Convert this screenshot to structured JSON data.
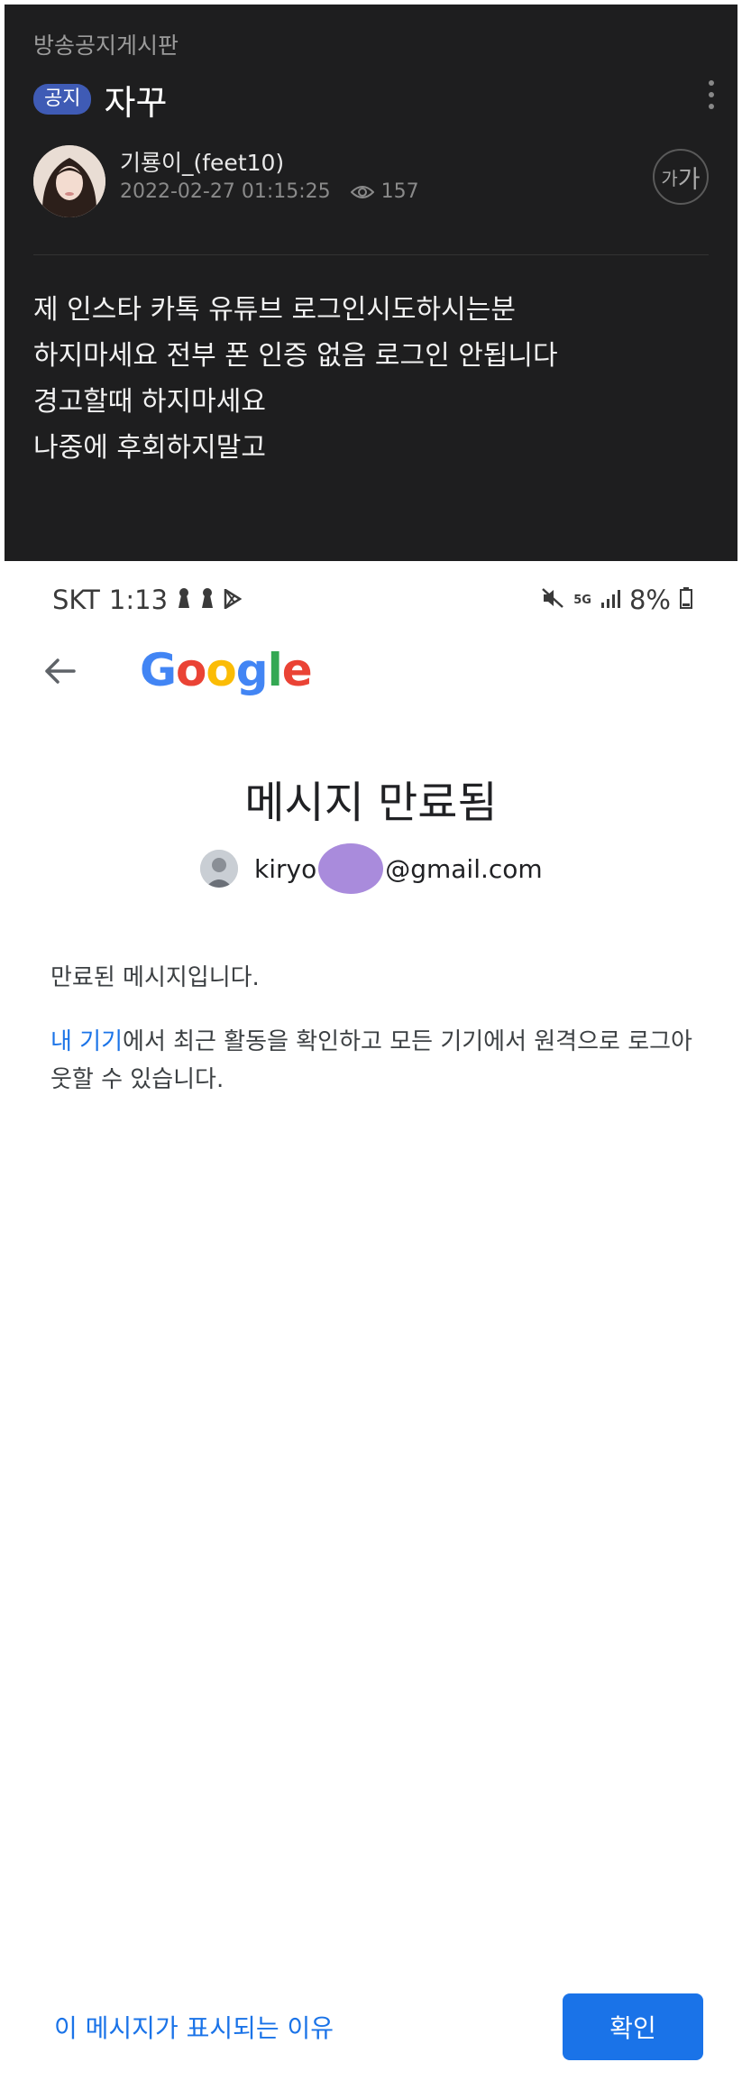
{
  "post": {
    "board_name": "방송공지게시판",
    "badge": "공지",
    "title": "자꾸",
    "author": "기룡이_(feet10)",
    "datetime": "2022-02-27 01:15:25",
    "views": "157",
    "font_button_small": "가",
    "font_button_large": "가",
    "body_lines": [
      "제 인스타 카톡 유튜브 로그인시도하시는분",
      "하지마세요 전부 폰 인증 없음 로그인 안됩니다",
      "경고할때 하지마세요",
      "나중에 후회하지말고"
    ]
  },
  "status_bar": {
    "carrier": "SKT",
    "time": "1:13",
    "network": "5G",
    "battery": "8%"
  },
  "google": {
    "logo_letters": [
      "G",
      "o",
      "o",
      "g",
      "l",
      "e"
    ],
    "logo_colors": [
      "#4285F4",
      "#EA4335",
      "#FBBC05",
      "#4285F4",
      "#34A853",
      "#EA4335"
    ],
    "heading": "메시지 만료됨",
    "account_prefix": "kiryo",
    "account_suffix": "@gmail.com",
    "message_expired": "만료된 메시지입니다.",
    "devices_link": "내 기기",
    "devices_text": "에서 최근 활동을 확인하고 모든 기기에서 원격으로 로그아웃할 수 있습니다.",
    "why_link": "이 메시지가 표시되는 이유",
    "confirm_button": "확인"
  },
  "colors": {
    "accent_blue": "#1a73e8",
    "badge_blue": "#3f5bb5",
    "redaction_purple": "#a98bdc"
  },
  "icons": [
    "kebab-menu-icon",
    "eye-icon",
    "font-size-icon",
    "keyhole-icon",
    "play-store-icon",
    "mute-icon",
    "signal-icon",
    "battery-icon",
    "back-arrow-icon"
  ]
}
